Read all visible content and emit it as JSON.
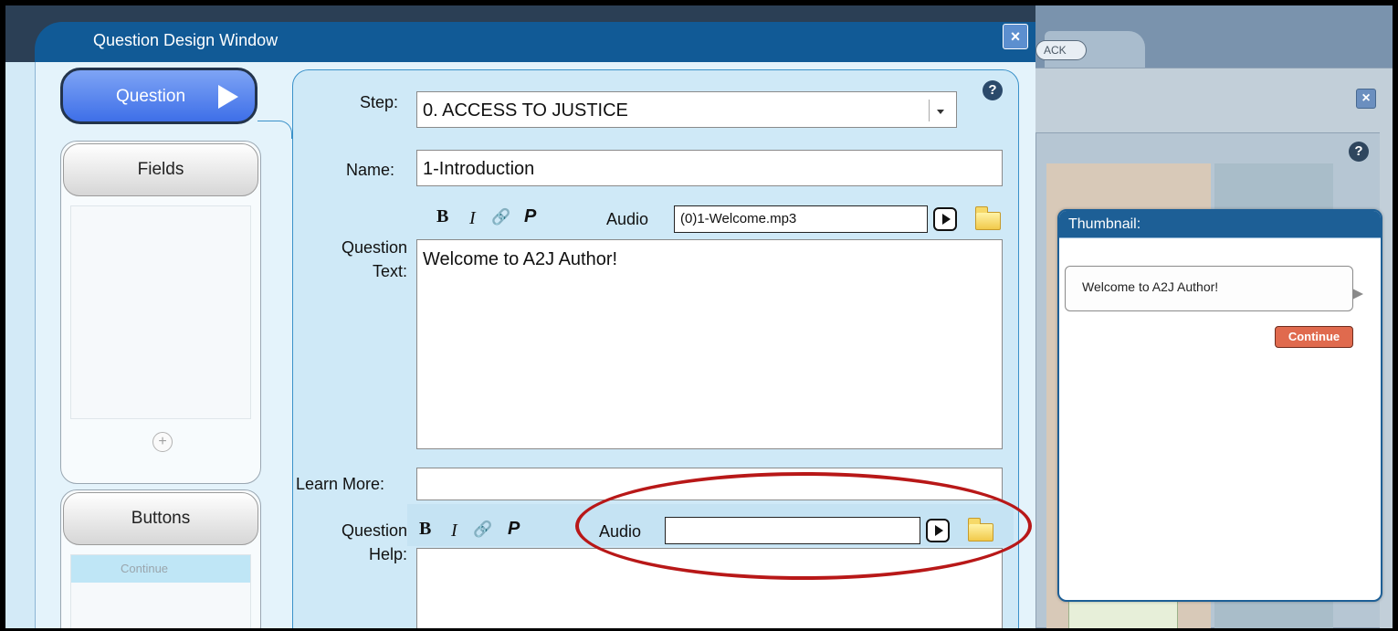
{
  "background": {
    "back_button_label": "ACK",
    "thumbnail": {
      "header": "Thumbnail:",
      "bubble_text": "Welcome to A2J Author!",
      "continue_label": "Continue"
    }
  },
  "dialog": {
    "title": "Question Design Window",
    "close_icon": "×",
    "help_icon": "?",
    "tabs": {
      "question_label": "Question",
      "fields_label": "Fields",
      "fields_add_icon": "+",
      "buttons_label": "Buttons",
      "buttons_items": [
        "Continue"
      ]
    },
    "form": {
      "step_label": "Step:",
      "step_value": "0. ACCESS TO JUSTICE",
      "name_label": "Name:",
      "name_value": "1-Introduction",
      "format_bold": "B",
      "format_italic": "I",
      "format_link": "🔗",
      "format_paragraph": "P",
      "audio_label": "Audio",
      "question_audio_value": "(0)1-Welcome.mp3",
      "question_text_label_line1": "Question",
      "question_text_label_line2": "Text:",
      "question_text_value": "Welcome to A2J Author!",
      "learn_more_label": "Learn More:",
      "learn_more_value": "",
      "question_help_label_line1": "Question",
      "question_help_label_line2": "Help:",
      "help_audio_value": "",
      "question_help_value": ""
    }
  },
  "colors": {
    "title_bar": "#115a96",
    "panel_bg": "#cfe9f7",
    "question_tab": "#3e6fe8",
    "highlight_oval": "#b81818",
    "continue_button": "#e06a4e"
  }
}
